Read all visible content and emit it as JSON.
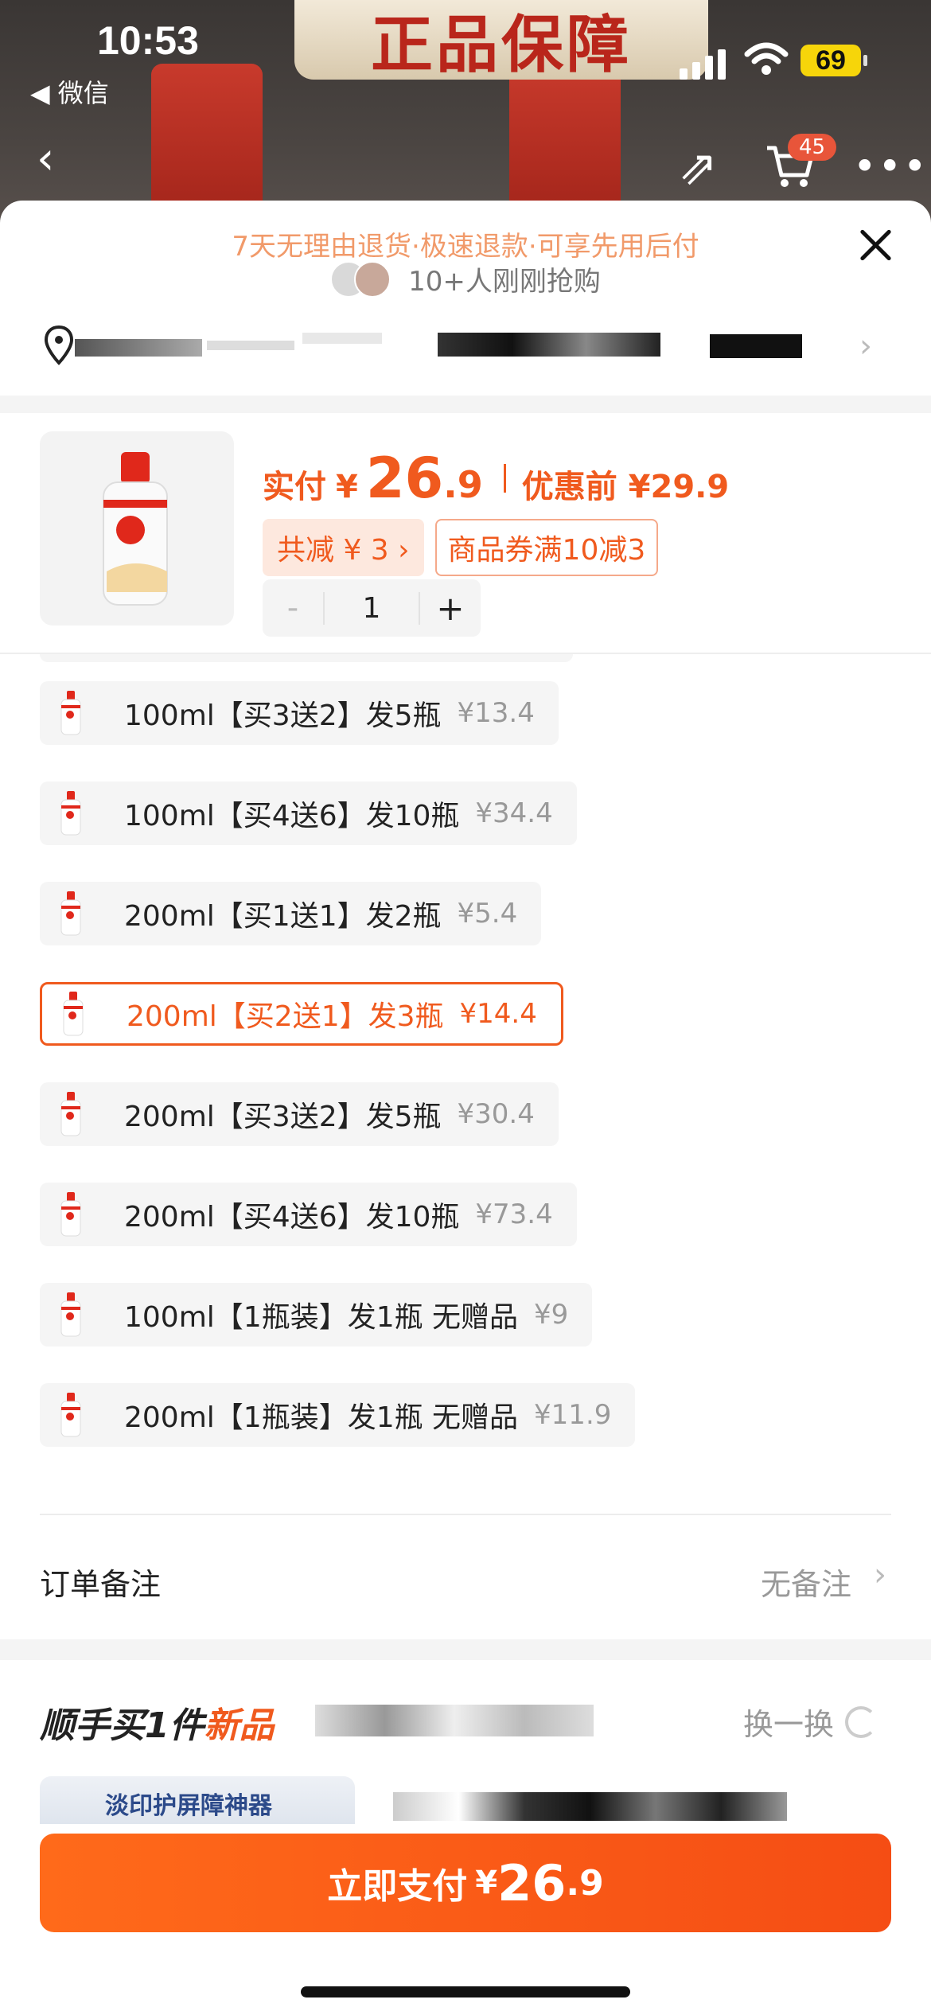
{
  "status_bar": {
    "time": "10:53",
    "back_app": "◀ 微信",
    "battery": "69"
  },
  "background": {
    "banner_text": "正品保障",
    "cart_count": "45"
  },
  "sheet": {
    "promise": "7天无理由退货·极速退款·可享先用后付",
    "buyers": "10+人刚刚抢购"
  },
  "product": {
    "price_label": "实付",
    "currency": "¥",
    "price_int": "26",
    "price_dec": ".9",
    "price_before": "优惠前 ¥29.9",
    "tag_total": "共减 ¥ 3 ›",
    "tag_coupon": "商品券满10减3",
    "qty_minus": "-",
    "qty": "1",
    "qty_plus": "+"
  },
  "options": [
    {
      "label": "100ml【买3送2】发5瓶",
      "price": "¥13.4",
      "selected": false
    },
    {
      "label": "100ml【买4送6】发10瓶",
      "price": "¥34.4",
      "selected": false
    },
    {
      "label": "200ml【买1送1】发2瓶",
      "price": "¥5.4",
      "selected": false
    },
    {
      "label": "200ml【买2送1】发3瓶",
      "price": "¥14.4",
      "selected": true
    },
    {
      "label": "200ml【买3送2】发5瓶",
      "price": "¥30.4",
      "selected": false
    },
    {
      "label": "200ml【买4送6】发10瓶",
      "price": "¥73.4",
      "selected": false
    },
    {
      "label": "100ml【1瓶装】发1瓶 无赠品",
      "price": "¥9",
      "selected": false
    },
    {
      "label": "200ml【1瓶装】发1瓶 无赠品",
      "price": "¥11.9",
      "selected": false
    }
  ],
  "order_note": {
    "label": "订单备注",
    "value": "无备注"
  },
  "addon": {
    "title_prefix": "顺手买1件",
    "title_highlight": "新品",
    "refresh_label": "换一换",
    "card_text": "淡印护屏障神器"
  },
  "pay": {
    "label": "立即支付",
    "currency": "¥",
    "amount_int": "26",
    "amount_dec": ".9"
  },
  "colors": {
    "accent": "#f05a1e",
    "promise": "#f19a6a"
  }
}
